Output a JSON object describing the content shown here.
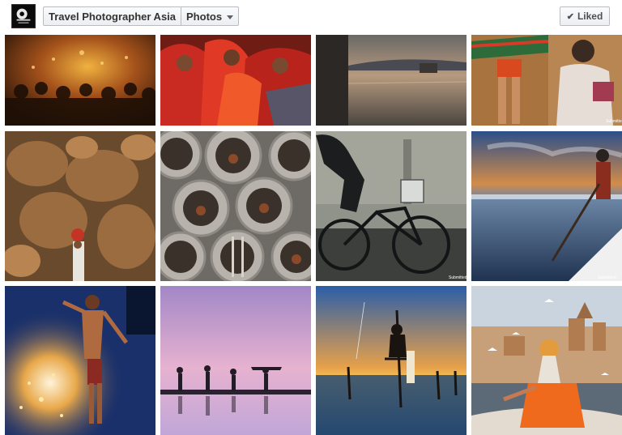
{
  "header": {
    "page_name": "Travel Photographer Asia",
    "section": "Photos",
    "liked_label": "Liked",
    "logo_icon": "travel-photographer-logo",
    "dropdown_icon": "caret-down-icon",
    "check_icon": "checkmark-icon"
  },
  "photos": [
    {
      "name": "photo-festival-crowd-fire"
    },
    {
      "name": "photo-women-in-red-saris"
    },
    {
      "name": "photo-lake-palace-dusk"
    },
    {
      "name": "photo-boys-ritual-mirror"
    },
    {
      "name": "photo-camel-fair-herder"
    },
    {
      "name": "photo-concrete-pipe-homes"
    },
    {
      "name": "photo-bicycle-rider-wall"
    },
    {
      "name": "photo-salt-pan-worker"
    },
    {
      "name": "photo-fire-walker-sparks"
    },
    {
      "name": "photo-salt-workers-silhouettes"
    },
    {
      "name": "photo-stilt-fisherman-sunset"
    },
    {
      "name": "photo-sadhu-boat-varanasi"
    }
  ],
  "watermark_text": "Submitted"
}
